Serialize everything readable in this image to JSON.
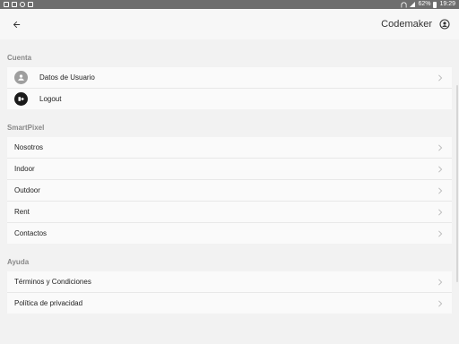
{
  "status_bar": {
    "battery_percent": "62%",
    "time": "19:29"
  },
  "app_bar": {
    "title": "Codemaker"
  },
  "sections": {
    "cuenta": {
      "title": "Cuenta",
      "items": [
        {
          "label": "Datos de Usuario",
          "icon": "user-avatar-icon"
        },
        {
          "label": "Logout",
          "icon": "logout-icon"
        }
      ]
    },
    "smartpixel": {
      "title": "SmartPixel",
      "items": [
        {
          "label": "Nosotros"
        },
        {
          "label": "Indoor"
        },
        {
          "label": "Outdoor"
        },
        {
          "label": "Rent"
        },
        {
          "label": "Contactos"
        }
      ]
    },
    "ayuda": {
      "title": "Ayuda",
      "items": [
        {
          "label": "Términos y Condiciones"
        },
        {
          "label": "Política de privacidad"
        }
      ]
    }
  },
  "icons": {
    "back": "arrow-back-icon",
    "account": "account-circle-icon",
    "chevron": "chevron-right-icon"
  },
  "colors": {
    "status_bar_bg": "#6e6e6e",
    "page_bg": "#f2f2f2",
    "row_bg": "#fafafa",
    "section_title": "#888888"
  }
}
